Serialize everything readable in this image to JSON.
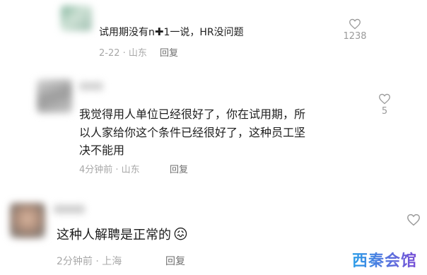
{
  "comments": [
    {
      "text_before": "试用期没有n",
      "plus": "✚",
      "text_after": "1一说，HR没问题",
      "meta": "2-22 · 山东",
      "reply": "回复",
      "likes": "1238"
    },
    {
      "lines": [
        "我觉得用人单位已经很好了，你在试用期，所",
        "以人家给你这个条件已经很好了，这种员工坚",
        "决不能用"
      ],
      "meta": "4分钟前 · 山东",
      "reply": "回复",
      "likes": "5"
    },
    {
      "text": "这种人解聘是正常的",
      "emoji": "😖",
      "meta": "2分钟前 · 上海",
      "reply": "回复"
    }
  ],
  "watermark": "西秦会馆",
  "colors": {
    "meta": "#a8a8a8",
    "reply": "#6f6f6f",
    "text": "#1e1e1e"
  }
}
